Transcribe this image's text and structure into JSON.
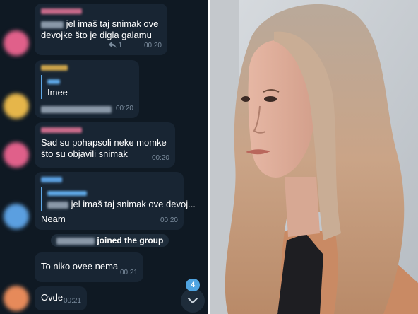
{
  "chat": {
    "messages": [
      {
        "text_before_blur": "",
        "text": "jel imaš taj snimak ove devojke što je digla galamu",
        "reply_count": "1",
        "time": "00:20",
        "avatar_color": "#e0608a"
      },
      {
        "quote_text": "Imee",
        "time": "00:20",
        "avatar_color": "#e6b64a"
      },
      {
        "text": "Sad su pohapsoli neke momke što su objavili snimak",
        "time": "00:20",
        "avatar_color": "#e0608a"
      },
      {
        "quote_text": "jel imaš taj snimak ove devoj...",
        "text": "Neam",
        "time": "00:20",
        "avatar_color": "#5b9fe0"
      },
      {
        "service_text": "joined the group"
      },
      {
        "text": "To niko ovee nema",
        "time": "00:21"
      },
      {
        "text": "Ovde",
        "time": "00:21",
        "avatar_color": "#e68a5a"
      }
    ],
    "unread_badge": "4"
  },
  "colors": {
    "chat_bg": "#0f1923",
    "bubble": "#182533",
    "accent": "#4fa3e0"
  },
  "icons": {
    "reply": "reply-arrow-icon",
    "scroll_down": "chevron-down-icon"
  }
}
